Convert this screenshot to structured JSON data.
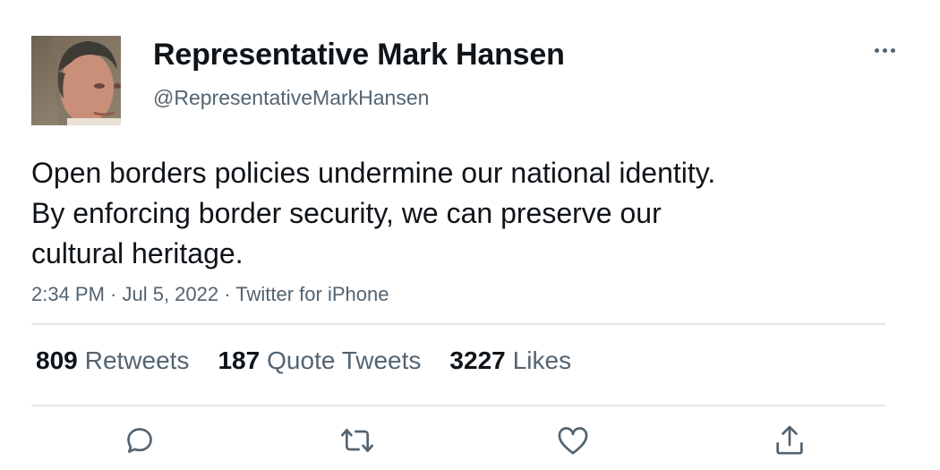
{
  "author": {
    "display_name": "Representative Mark Hansen",
    "handle": "@RepresentativeMarkHansen"
  },
  "tweet": {
    "lines": [
      "Open borders policies undermine our national identity.",
      "By enforcing border security, we can preserve our",
      "cultural heritage."
    ],
    "meta": "2:34 PM · Jul 5, 2022 · Twitter for iPhone"
  },
  "stats": {
    "retweets_count": "809",
    "retweets_label": "Retweets",
    "quotes_count": "187",
    "quotes_label": "Quote Tweets",
    "likes_count": "3227",
    "likes_label": "Likes"
  },
  "icons": {
    "more": "more-horizontal-icon",
    "reply": "reply-icon",
    "retweet": "retweet-icon",
    "like": "heart-icon",
    "share": "share-icon"
  },
  "colors": {
    "text": "#0f1419",
    "secondary": "#536471",
    "divider": "#e4e7ea"
  }
}
